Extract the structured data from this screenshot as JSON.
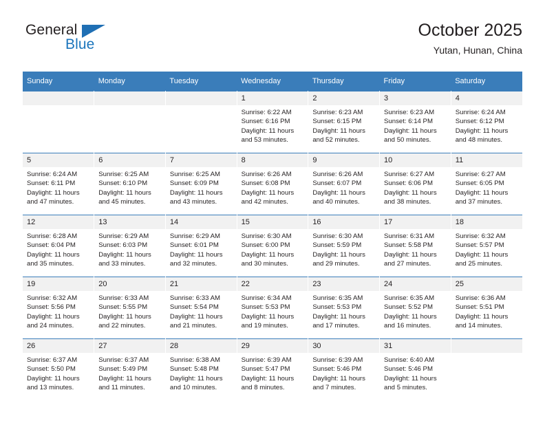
{
  "brand": {
    "name_top": "General",
    "name_bottom": "Blue",
    "triangle_color": "#1f6fb4",
    "blue_text_color": "#1b75bc"
  },
  "header": {
    "title": "October 2025",
    "subtitle": "Yutan, Hunan, China"
  },
  "theme": {
    "header_row_bg": "#3a7dba",
    "header_row_text": "#ffffff",
    "daynum_bg": "#f1f1f1",
    "cell_bg": "#ffffff",
    "text_color": "#231f20"
  },
  "weekdays": [
    "Sunday",
    "Monday",
    "Tuesday",
    "Wednesday",
    "Thursday",
    "Friday",
    "Saturday"
  ],
  "labels": {
    "sunrise_prefix": "Sunrise:",
    "sunset_prefix": "Sunset:",
    "daylight_prefix": "Daylight:"
  },
  "weeks": [
    [
      {
        "day": "",
        "blank": true
      },
      {
        "day": "",
        "blank": true
      },
      {
        "day": "",
        "blank": true
      },
      {
        "day": "1",
        "sunrise": "Sunrise: 6:22 AM",
        "sunset": "Sunset: 6:16 PM",
        "daylight_l1": "Daylight: 11 hours",
        "daylight_l2": "and 53 minutes."
      },
      {
        "day": "2",
        "sunrise": "Sunrise: 6:23 AM",
        "sunset": "Sunset: 6:15 PM",
        "daylight_l1": "Daylight: 11 hours",
        "daylight_l2": "and 52 minutes."
      },
      {
        "day": "3",
        "sunrise": "Sunrise: 6:23 AM",
        "sunset": "Sunset: 6:14 PM",
        "daylight_l1": "Daylight: 11 hours",
        "daylight_l2": "and 50 minutes."
      },
      {
        "day": "4",
        "sunrise": "Sunrise: 6:24 AM",
        "sunset": "Sunset: 6:12 PM",
        "daylight_l1": "Daylight: 11 hours",
        "daylight_l2": "and 48 minutes."
      }
    ],
    [
      {
        "day": "5",
        "sunrise": "Sunrise: 6:24 AM",
        "sunset": "Sunset: 6:11 PM",
        "daylight_l1": "Daylight: 11 hours",
        "daylight_l2": "and 47 minutes."
      },
      {
        "day": "6",
        "sunrise": "Sunrise: 6:25 AM",
        "sunset": "Sunset: 6:10 PM",
        "daylight_l1": "Daylight: 11 hours",
        "daylight_l2": "and 45 minutes."
      },
      {
        "day": "7",
        "sunrise": "Sunrise: 6:25 AM",
        "sunset": "Sunset: 6:09 PM",
        "daylight_l1": "Daylight: 11 hours",
        "daylight_l2": "and 43 minutes."
      },
      {
        "day": "8",
        "sunrise": "Sunrise: 6:26 AM",
        "sunset": "Sunset: 6:08 PM",
        "daylight_l1": "Daylight: 11 hours",
        "daylight_l2": "and 42 minutes."
      },
      {
        "day": "9",
        "sunrise": "Sunrise: 6:26 AM",
        "sunset": "Sunset: 6:07 PM",
        "daylight_l1": "Daylight: 11 hours",
        "daylight_l2": "and 40 minutes."
      },
      {
        "day": "10",
        "sunrise": "Sunrise: 6:27 AM",
        "sunset": "Sunset: 6:06 PM",
        "daylight_l1": "Daylight: 11 hours",
        "daylight_l2": "and 38 minutes."
      },
      {
        "day": "11",
        "sunrise": "Sunrise: 6:27 AM",
        "sunset": "Sunset: 6:05 PM",
        "daylight_l1": "Daylight: 11 hours",
        "daylight_l2": "and 37 minutes."
      }
    ],
    [
      {
        "day": "12",
        "sunrise": "Sunrise: 6:28 AM",
        "sunset": "Sunset: 6:04 PM",
        "daylight_l1": "Daylight: 11 hours",
        "daylight_l2": "and 35 minutes."
      },
      {
        "day": "13",
        "sunrise": "Sunrise: 6:29 AM",
        "sunset": "Sunset: 6:03 PM",
        "daylight_l1": "Daylight: 11 hours",
        "daylight_l2": "and 33 minutes."
      },
      {
        "day": "14",
        "sunrise": "Sunrise: 6:29 AM",
        "sunset": "Sunset: 6:01 PM",
        "daylight_l1": "Daylight: 11 hours",
        "daylight_l2": "and 32 minutes."
      },
      {
        "day": "15",
        "sunrise": "Sunrise: 6:30 AM",
        "sunset": "Sunset: 6:00 PM",
        "daylight_l1": "Daylight: 11 hours",
        "daylight_l2": "and 30 minutes."
      },
      {
        "day": "16",
        "sunrise": "Sunrise: 6:30 AM",
        "sunset": "Sunset: 5:59 PM",
        "daylight_l1": "Daylight: 11 hours",
        "daylight_l2": "and 29 minutes."
      },
      {
        "day": "17",
        "sunrise": "Sunrise: 6:31 AM",
        "sunset": "Sunset: 5:58 PM",
        "daylight_l1": "Daylight: 11 hours",
        "daylight_l2": "and 27 minutes."
      },
      {
        "day": "18",
        "sunrise": "Sunrise: 6:32 AM",
        "sunset": "Sunset: 5:57 PM",
        "daylight_l1": "Daylight: 11 hours",
        "daylight_l2": "and 25 minutes."
      }
    ],
    [
      {
        "day": "19",
        "sunrise": "Sunrise: 6:32 AM",
        "sunset": "Sunset: 5:56 PM",
        "daylight_l1": "Daylight: 11 hours",
        "daylight_l2": "and 24 minutes."
      },
      {
        "day": "20",
        "sunrise": "Sunrise: 6:33 AM",
        "sunset": "Sunset: 5:55 PM",
        "daylight_l1": "Daylight: 11 hours",
        "daylight_l2": "and 22 minutes."
      },
      {
        "day": "21",
        "sunrise": "Sunrise: 6:33 AM",
        "sunset": "Sunset: 5:54 PM",
        "daylight_l1": "Daylight: 11 hours",
        "daylight_l2": "and 21 minutes."
      },
      {
        "day": "22",
        "sunrise": "Sunrise: 6:34 AM",
        "sunset": "Sunset: 5:53 PM",
        "daylight_l1": "Daylight: 11 hours",
        "daylight_l2": "and 19 minutes."
      },
      {
        "day": "23",
        "sunrise": "Sunrise: 6:35 AM",
        "sunset": "Sunset: 5:53 PM",
        "daylight_l1": "Daylight: 11 hours",
        "daylight_l2": "and 17 minutes."
      },
      {
        "day": "24",
        "sunrise": "Sunrise: 6:35 AM",
        "sunset": "Sunset: 5:52 PM",
        "daylight_l1": "Daylight: 11 hours",
        "daylight_l2": "and 16 minutes."
      },
      {
        "day": "25",
        "sunrise": "Sunrise: 6:36 AM",
        "sunset": "Sunset: 5:51 PM",
        "daylight_l1": "Daylight: 11 hours",
        "daylight_l2": "and 14 minutes."
      }
    ],
    [
      {
        "day": "26",
        "sunrise": "Sunrise: 6:37 AM",
        "sunset": "Sunset: 5:50 PM",
        "daylight_l1": "Daylight: 11 hours",
        "daylight_l2": "and 13 minutes."
      },
      {
        "day": "27",
        "sunrise": "Sunrise: 6:37 AM",
        "sunset": "Sunset: 5:49 PM",
        "daylight_l1": "Daylight: 11 hours",
        "daylight_l2": "and 11 minutes."
      },
      {
        "day": "28",
        "sunrise": "Sunrise: 6:38 AM",
        "sunset": "Sunset: 5:48 PM",
        "daylight_l1": "Daylight: 11 hours",
        "daylight_l2": "and 10 minutes."
      },
      {
        "day": "29",
        "sunrise": "Sunrise: 6:39 AM",
        "sunset": "Sunset: 5:47 PM",
        "daylight_l1": "Daylight: 11 hours",
        "daylight_l2": "and 8 minutes."
      },
      {
        "day": "30",
        "sunrise": "Sunrise: 6:39 AM",
        "sunset": "Sunset: 5:46 PM",
        "daylight_l1": "Daylight: 11 hours",
        "daylight_l2": "and 7 minutes."
      },
      {
        "day": "31",
        "sunrise": "Sunrise: 6:40 AM",
        "sunset": "Sunset: 5:46 PM",
        "daylight_l1": "Daylight: 11 hours",
        "daylight_l2": "and 5 minutes."
      },
      {
        "day": "",
        "blank": true
      }
    ]
  ]
}
